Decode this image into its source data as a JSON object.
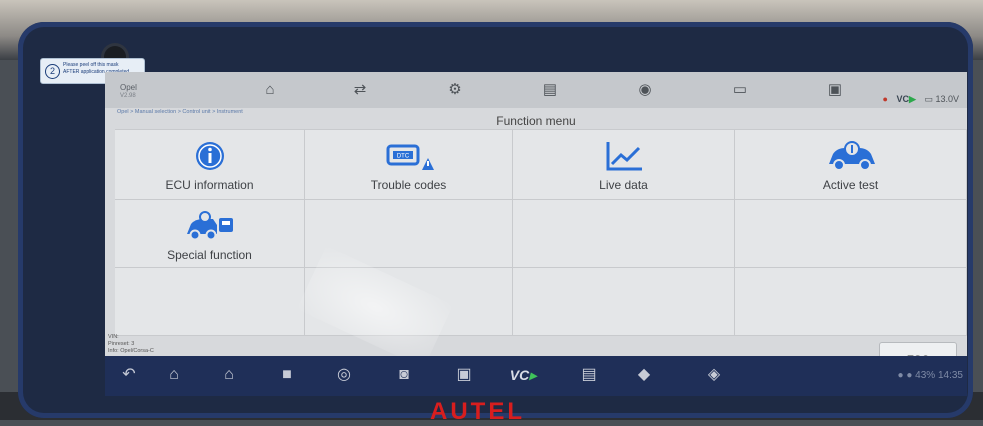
{
  "sticker": {
    "number": "2",
    "line1": "Please peel off this mask",
    "line2": "AFTER application completed"
  },
  "app": {
    "brand": "Opel",
    "version": "V2.98"
  },
  "status": {
    "vci": "VC",
    "battery": "13.0V"
  },
  "breadcrumb": "Opel > Manual selection > Control unit > Instrument",
  "menu": {
    "title": "Function menu",
    "items": [
      {
        "label": "ECU information",
        "icon": "info-icon"
      },
      {
        "label": "Trouble codes",
        "icon": "dtc-engine-icon"
      },
      {
        "label": "Live data",
        "icon": "line-chart-icon"
      },
      {
        "label": "Active test",
        "icon": "car-wrench-icon"
      },
      {
        "label": "Special function",
        "icon": "vehicle-service-icon"
      }
    ]
  },
  "info": {
    "vin": "VIN:",
    "pinreset": "Pinreset: 3",
    "info": "Info: Opel/Corsa-C"
  },
  "esc_label": "ESC",
  "system": {
    "battery": "43%",
    "time": "14:35"
  },
  "device_logo": "AUTEL"
}
